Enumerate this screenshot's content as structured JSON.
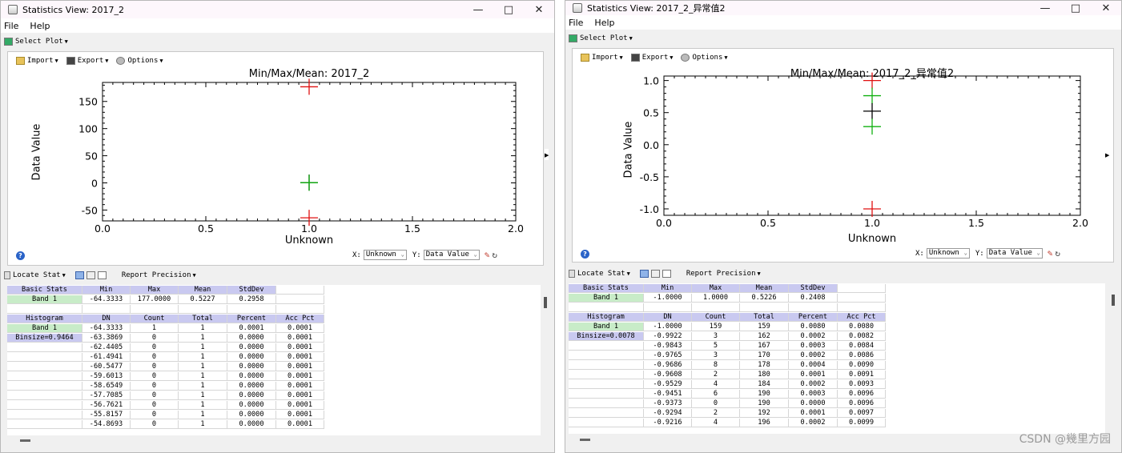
{
  "windows": [
    {
      "title": "Statistics View: 2017_2",
      "menu": [
        "File",
        "Help"
      ],
      "select_plot": "Select Plot",
      "plot_toolbar": {
        "import": "Import",
        "export": "Export",
        "options": "Options"
      },
      "chart_data": {
        "type": "scatter",
        "title": "Min/Max/Mean: 2017_2",
        "xlabel": "Unknown",
        "ylabel": "Data Value",
        "xlim": [
          0.0,
          2.0
        ],
        "ylim": [
          -70,
          185
        ],
        "xticks": [
          "0.0",
          "0.5",
          "1.0",
          "1.5",
          "2.0"
        ],
        "xtick_values": [
          0.0,
          0.5,
          1.0,
          1.5,
          2.0
        ],
        "yticks": [
          "150",
          "100",
          "50",
          "0",
          "-50"
        ],
        "ytick_values": [
          150,
          100,
          50,
          0,
          -50
        ],
        "points": [
          {
            "x": 1.0,
            "y": 177.0,
            "color": "#e01010"
          },
          {
            "x": 1.0,
            "y": 0.5227,
            "color": "#000000"
          },
          {
            "x": 1.0,
            "y": 0.2958,
            "color": "#10b010"
          },
          {
            "x": 1.0,
            "y": -64.3333,
            "color": "#e01010"
          }
        ]
      },
      "xy": {
        "x_label": "X:",
        "x_value": "Unknown",
        "y_label": "Y:",
        "y_value": "Data Value"
      },
      "locate_stat": "Locate Stat",
      "report_precision": "Report Precision",
      "basic_stats": {
        "headers": [
          "Basic Stats",
          "Min",
          "Max",
          "Mean",
          "StdDev"
        ],
        "row": [
          "Band 1",
          "-64.3333",
          "177.0000",
          "0.5227",
          "0.2958"
        ]
      },
      "histogram": {
        "headers": [
          "Histogram",
          "DN",
          "Count",
          "Total",
          "Percent",
          "Acc Pct"
        ],
        "band": "Band 1",
        "binsize": "Binsize=0.9464",
        "rows": [
          [
            "-64.3333",
            "1",
            "1",
            "0.0001",
            "0.0001"
          ],
          [
            "-63.3869",
            "0",
            "1",
            "0.0000",
            "0.0001"
          ],
          [
            "-62.4405",
            "0",
            "1",
            "0.0000",
            "0.0001"
          ],
          [
            "-61.4941",
            "0",
            "1",
            "0.0000",
            "0.0001"
          ],
          [
            "-60.5477",
            "0",
            "1",
            "0.0000",
            "0.0001"
          ],
          [
            "-59.6013",
            "0",
            "1",
            "0.0000",
            "0.0001"
          ],
          [
            "-58.6549",
            "0",
            "1",
            "0.0000",
            "0.0001"
          ],
          [
            "-57.7085",
            "0",
            "1",
            "0.0000",
            "0.0001"
          ],
          [
            "-56.7621",
            "0",
            "1",
            "0.0000",
            "0.0001"
          ],
          [
            "-55.8157",
            "0",
            "1",
            "0.0000",
            "0.0001"
          ],
          [
            "-54.8693",
            "0",
            "1",
            "0.0000",
            "0.0001"
          ]
        ]
      }
    },
    {
      "title": "Statistics View: 2017_2_异常值2",
      "menu": [
        "File",
        "Help"
      ],
      "select_plot": "Select Plot",
      "plot_toolbar": {
        "import": "Import",
        "export": "Export",
        "options": "Options"
      },
      "chart_data": {
        "type": "scatter",
        "title": "Min/Max/Mean: 2017_2_异常值2",
        "xlabel": "Unknown",
        "ylabel": "Data Value",
        "xlim": [
          0.0,
          2.0
        ],
        "ylim": [
          -1.1,
          1.07
        ],
        "xticks": [
          "0.0",
          "0.5",
          "1.0",
          "1.5",
          "2.0"
        ],
        "xtick_values": [
          0.0,
          0.5,
          1.0,
          1.5,
          2.0
        ],
        "yticks": [
          "1.0",
          "0.5",
          "0.0",
          "-0.5",
          "-1.0"
        ],
        "ytick_values": [
          1.0,
          0.5,
          0.0,
          -0.5,
          -1.0
        ],
        "points": [
          {
            "x": 1.0,
            "y": 1.0,
            "color": "#e01010"
          },
          {
            "x": 1.0,
            "y": 0.7634,
            "color": "#10b010"
          },
          {
            "x": 1.0,
            "y": 0.5226,
            "color": "#000000"
          },
          {
            "x": 1.0,
            "y": 0.2818,
            "color": "#10b010"
          },
          {
            "x": 1.0,
            "y": -1.0,
            "color": "#e01010"
          }
        ]
      },
      "xy": {
        "x_label": "X:",
        "x_value": "Unknown",
        "y_label": "Y:",
        "y_value": "Data Value"
      },
      "locate_stat": "Locate Stat",
      "report_precision": "Report Precision",
      "basic_stats": {
        "headers": [
          "Basic Stats",
          "Min",
          "Max",
          "Mean",
          "StdDev"
        ],
        "row": [
          "Band 1",
          "-1.0000",
          "1.0000",
          "0.5226",
          "0.2408"
        ]
      },
      "histogram": {
        "headers": [
          "Histogram",
          "DN",
          "Count",
          "Total",
          "Percent",
          "Acc Pct"
        ],
        "band": "Band 1",
        "binsize": "Binsize=0.0078",
        "rows": [
          [
            "-1.0000",
            "159",
            "159",
            "0.0080",
            "0.0080"
          ],
          [
            "-0.9922",
            "3",
            "162",
            "0.0002",
            "0.0082"
          ],
          [
            "-0.9843",
            "5",
            "167",
            "0.0003",
            "0.0084"
          ],
          [
            "-0.9765",
            "3",
            "170",
            "0.0002",
            "0.0086"
          ],
          [
            "-0.9686",
            "8",
            "178",
            "0.0004",
            "0.0090"
          ],
          [
            "-0.9608",
            "2",
            "180",
            "0.0001",
            "0.0091"
          ],
          [
            "-0.9529",
            "4",
            "184",
            "0.0002",
            "0.0093"
          ],
          [
            "-0.9451",
            "6",
            "190",
            "0.0003",
            "0.0096"
          ],
          [
            "-0.9373",
            "0",
            "190",
            "0.0000",
            "0.0096"
          ],
          [
            "-0.9294",
            "2",
            "192",
            "0.0001",
            "0.0097"
          ],
          [
            "-0.9216",
            "4",
            "196",
            "0.0002",
            "0.0099"
          ]
        ]
      }
    }
  ],
  "watermark": "CSDN @幾里方园"
}
